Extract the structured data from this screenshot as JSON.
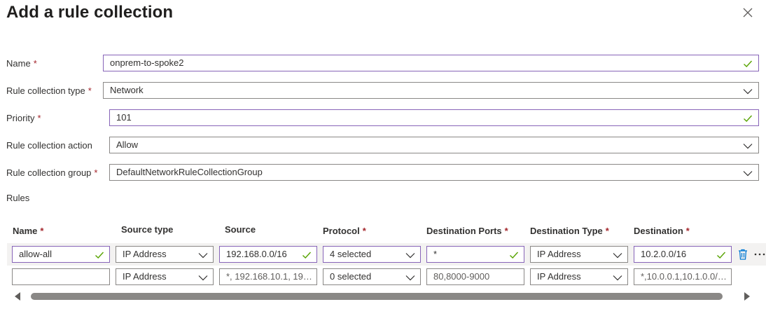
{
  "panel": {
    "title": "Add a rule collection",
    "close_icon": "close-icon"
  },
  "form": {
    "required_marker": "*",
    "name": {
      "label": "Name",
      "value": "onprem-to-spoke2"
    },
    "type": {
      "label": "Rule collection type",
      "value": "Network"
    },
    "priority": {
      "label": "Priority",
      "value": "101"
    },
    "action": {
      "label": "Rule collection action",
      "value": "Allow"
    },
    "group": {
      "label": "Rule collection group",
      "value": "DefaultNetworkRuleCollectionGroup"
    },
    "rules_label": "Rules"
  },
  "rules_table": {
    "columns": {
      "name": "Name",
      "source_type": "Source type",
      "source": "Source",
      "protocol": "Protocol",
      "destination_ports": "Destination Ports",
      "destination_type": "Destination Type",
      "destination": "Destination"
    },
    "rows": [
      {
        "name": "allow-all",
        "source_type": "IP Address",
        "source": "192.168.0.0/16",
        "protocol": "4 selected",
        "destination_ports": "*",
        "destination_type": "IP Address",
        "destination": "10.2.0.0/16"
      },
      {
        "name": "",
        "source_type": "IP Address",
        "source_placeholder": "*, 192.168.10.1, 192...",
        "protocol": "0 selected",
        "destination_ports_placeholder": "80,8000-9000",
        "destination_type": "IP Address",
        "destination_placeholder": "*,10.0.0.1,10.1.0.0/1..."
      }
    ]
  },
  "colors": {
    "valid_border": "#8764b8",
    "check": "#57a300",
    "required": "#a4262c",
    "trash": "#0078d4",
    "scroll_thumb": "#8a8886"
  }
}
